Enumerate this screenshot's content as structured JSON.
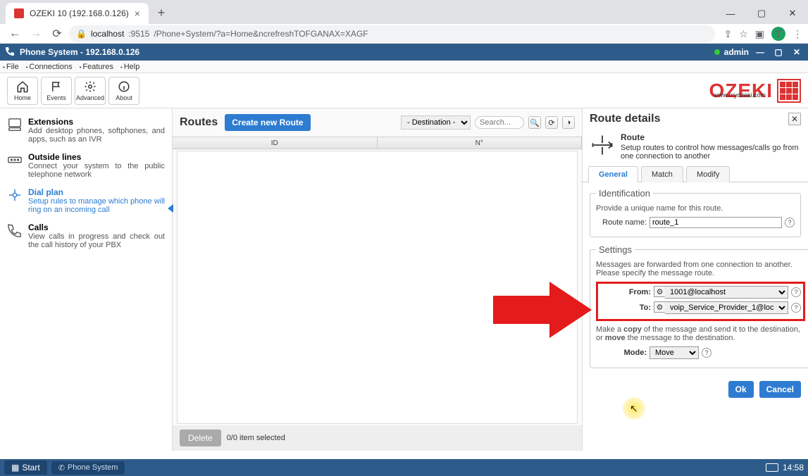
{
  "browser": {
    "tab_title": "OZEKI 10 (192.168.0.126)",
    "url_host": "localhost",
    "url_port": ":9515",
    "url_path": "/Phone+System/?a=Home&ncrefreshTOFGANAX=XAGF",
    "profile_letter": "T"
  },
  "window_controls": {
    "minimize": "—",
    "maximize": "▢",
    "close": "✕"
  },
  "app_bar": {
    "title": "Phone System - 192.168.0.126",
    "user": "admin"
  },
  "menus": {
    "file": "File",
    "connections": "Connections",
    "features": "Features",
    "help": "Help"
  },
  "toolbar": {
    "home": "Home",
    "events": "Events",
    "advanced": "Advanced",
    "about": "About"
  },
  "logo": {
    "text": "OZEKI",
    "sub": "www.myozeki.com"
  },
  "sidebar": {
    "items": [
      {
        "title": "Extensions",
        "desc": "Add desktop phones, softphones, and apps, such as an IVR"
      },
      {
        "title": "Outside lines",
        "desc": "Connect your system to the public telephone network"
      },
      {
        "title": "Dial plan",
        "desc": "Setup rules to manage which phone will ring on an incoming call"
      },
      {
        "title": "Calls",
        "desc": "View calls in progress and check out the call history of your PBX"
      }
    ]
  },
  "center": {
    "title": "Routes",
    "create_btn": "Create new Route",
    "dest_label": "- Destination -",
    "search_placeholder": "Search...",
    "col_id": "ID",
    "col_no": "N°",
    "delete_btn": "Delete",
    "selection_text": "0/0 item selected"
  },
  "right": {
    "title": "Route details",
    "desc_title": "Route",
    "desc_text": "Setup routes to control how messages/calls go from one connection to another",
    "tabs": {
      "general": "General",
      "match": "Match",
      "modify": "Modify"
    },
    "ident_legend": "Identification",
    "ident_hint": "Provide a unique name for this route.",
    "route_name_label": "Route name:",
    "route_name_value": "route_1",
    "settings_legend": "Settings",
    "settings_hint": "Messages are forwarded from one connection to another. Please specify the message route.",
    "from_label": "From:",
    "from_value": "1001@localhost",
    "to_label": "To:",
    "to_value": "voip_Service_Provider_1@loc",
    "copy_line_1": "Make a ",
    "copy_bold": "copy",
    "copy_line_2": " of the message and send it to the destination, or ",
    "move_bold": "move",
    "copy_line_3": " the message to the destination.",
    "mode_label": "Mode:",
    "mode_value": "Move",
    "ok_btn": "Ok",
    "cancel_btn": "Cancel"
  },
  "taskbar": {
    "start": "Start",
    "task1": "Phone System",
    "clock": "14:58"
  }
}
